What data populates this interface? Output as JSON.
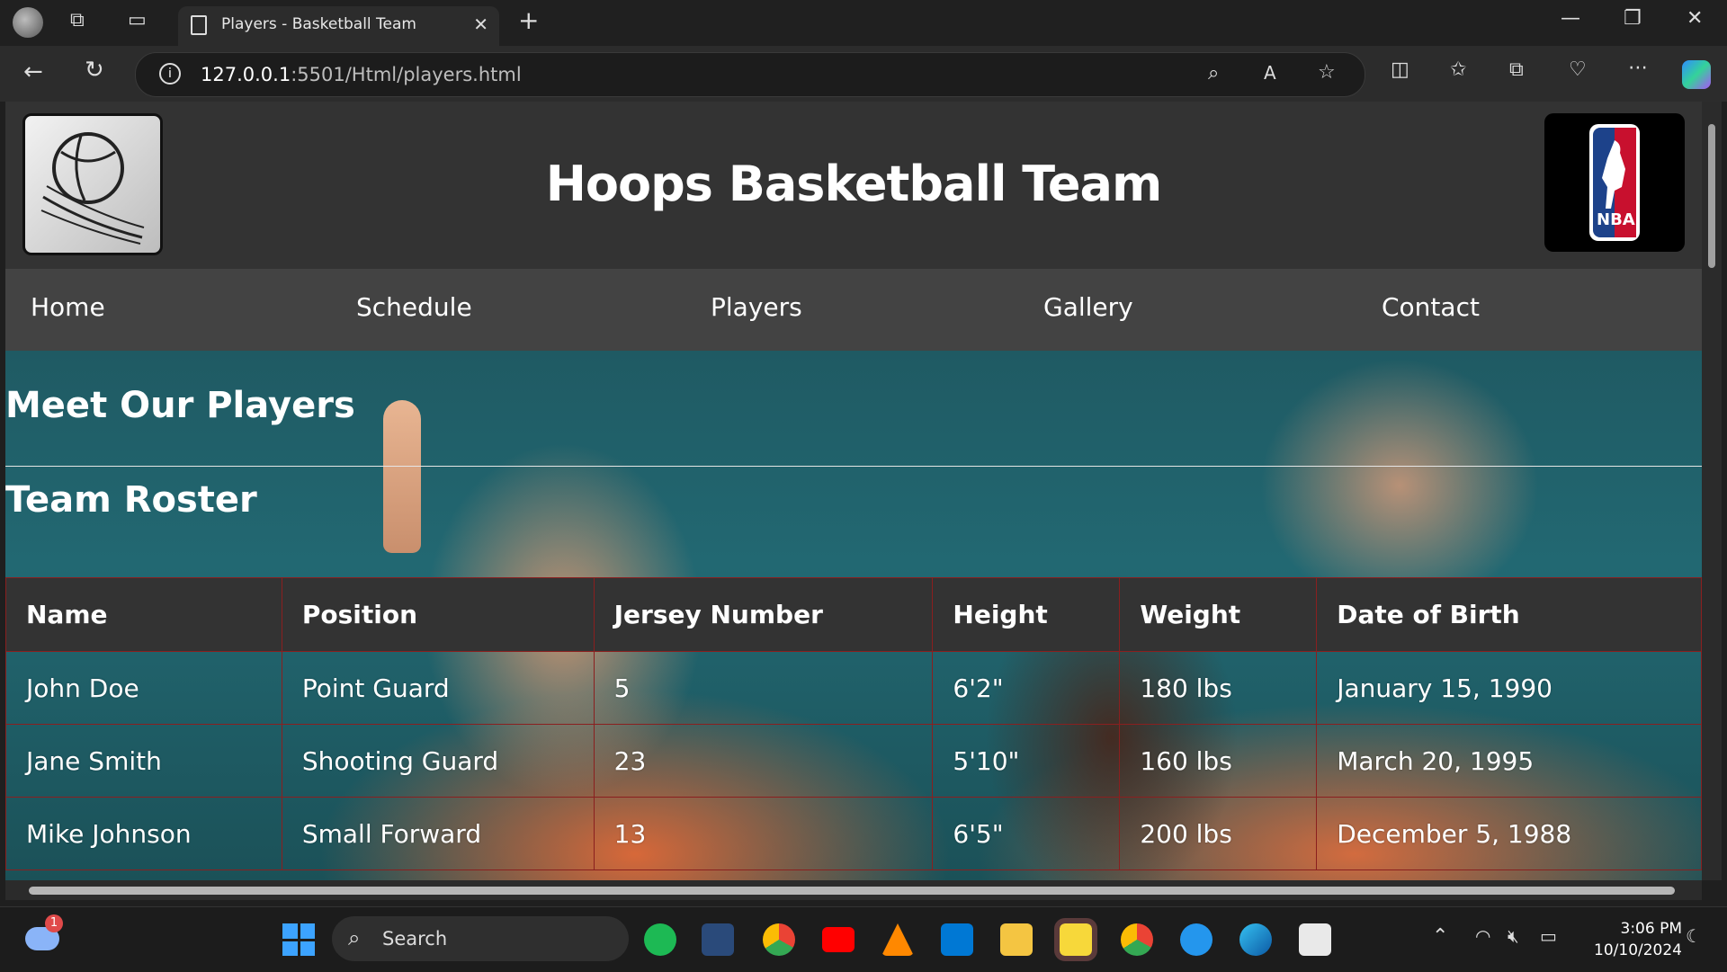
{
  "browser": {
    "tab_title": "Players - Basketball Team",
    "url_host": "127.0.0.1",
    "url_path": ":5501/Html/players.html"
  },
  "site": {
    "title": "Hoops Basketball Team",
    "nav": [
      "Home",
      "Schedule",
      "Players",
      "Gallery",
      "Contact"
    ],
    "heading": "Meet Our Players",
    "subheading": "Team Roster",
    "logo_right_text": "NBA"
  },
  "roster": {
    "headers": [
      "Name",
      "Position",
      "Jersey Number",
      "Height",
      "Weight",
      "Date of Birth"
    ],
    "rows": [
      [
        "John Doe",
        "Point Guard",
        "5",
        "6'2\"",
        "180 lbs",
        "January 15, 1990"
      ],
      [
        "Jane Smith",
        "Shooting Guard",
        "23",
        "5'10\"",
        "160 lbs",
        "March 20, 1995"
      ],
      [
        "Mike Johnson",
        "Small Forward",
        "13",
        "6'5\"",
        "200 lbs",
        "December 5, 1988"
      ]
    ]
  },
  "taskbar": {
    "search_label": "Search",
    "time": "3:06 PM",
    "date": "10/10/2024",
    "weather_badge": "1"
  },
  "colors": {
    "nav_bg": "#434343",
    "header_bg": "#333333",
    "table_border": "#8a1f1f"
  }
}
